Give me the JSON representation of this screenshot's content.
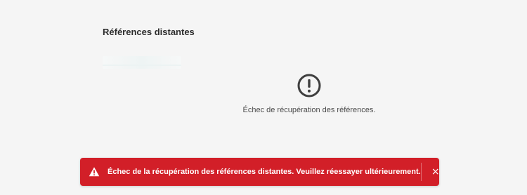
{
  "panel": {
    "title": "Références distantes"
  },
  "error_state": {
    "icon": "exclamation-circle-icon",
    "message": "Échec de récupération des références."
  },
  "toast": {
    "icon": "warning-triangle-icon",
    "message": "Échec de la récupération des références distantes. Veuillez réessayer ultérieurement.",
    "close_label": "×",
    "background": "#d21f28"
  }
}
